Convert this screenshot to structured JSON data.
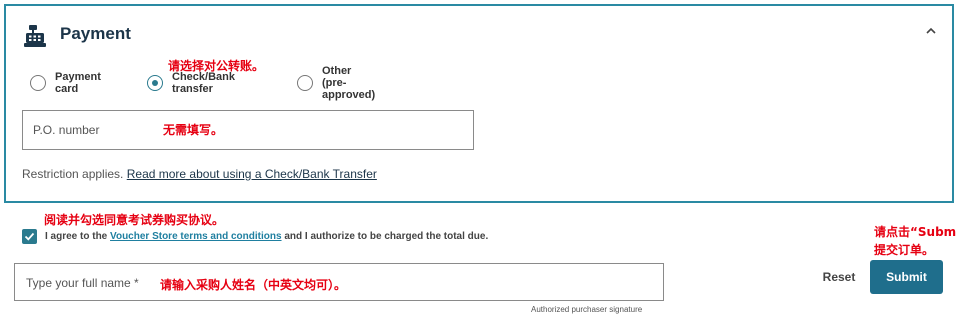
{
  "payment": {
    "title": "Payment",
    "options": [
      {
        "label": "Payment card",
        "selected": false
      },
      {
        "label": "Check/Bank transfer",
        "selected": true
      },
      {
        "label": "Other (pre-approved)",
        "selected": false
      }
    ],
    "po_placeholder": "P.O. number",
    "restriction_text": "Restriction applies.",
    "restriction_link": "Read more about using a Check/Bank Transfer"
  },
  "agreement": {
    "checked": true,
    "prefix": "I agree to the",
    "terms_link": "Voucher Store terms and conditions",
    "suffix": "and I authorize to be charged the total due."
  },
  "signature": {
    "placeholder": "Type your full name *",
    "caption": "Authorized purchaser signature"
  },
  "actions": {
    "reset_label": "Reset",
    "submit_label": "Submit"
  },
  "annotations": {
    "choose_transfer": "请选择对公转账。",
    "no_need_fill": "无需填写。",
    "read_agree": "阅读并勾选同意考试券购买协议。",
    "enter_name": "请输入采购人姓名（中英文均可）。",
    "click_submit_line1": "请点击“Submit”",
    "click_submit_line2": "提交订单。"
  },
  "colors": {
    "accent": "#2a8aa3",
    "primary_button": "#1f6e8c",
    "annotation": "#e60012"
  },
  "icons": {
    "header": "cash-register-icon",
    "collapse": "chevron-up-icon",
    "checkbox": "check-icon"
  }
}
